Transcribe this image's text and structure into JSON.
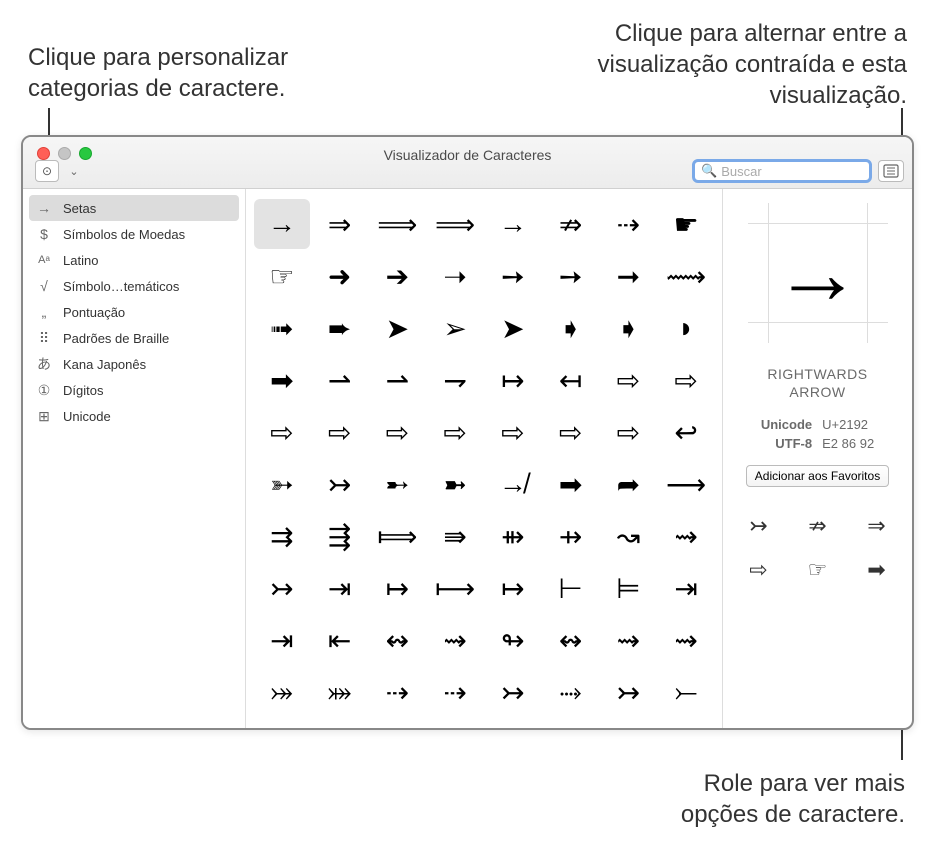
{
  "callouts": {
    "top_left": "Clique para personalizar categorias de caractere.",
    "top_right": "Clique para alternar entre a visualização contraída e esta visualização.",
    "bottom_right": "Role para ver mais opções de caractere."
  },
  "window": {
    "title": "Visualizador de Caracteres",
    "search_placeholder": "Buscar"
  },
  "sidebar": {
    "items": [
      {
        "icon": "→",
        "label": "Setas",
        "selected": true
      },
      {
        "icon": "$",
        "label": "Símbolos de Moedas"
      },
      {
        "icon": "Aあ",
        "label": "Latino"
      },
      {
        "icon": "√",
        "label": "Símbolo…temáticos"
      },
      {
        "icon": "„",
        "label": "Pontuação"
      },
      {
        "icon": "⠿",
        "label": "Padrões de Braille"
      },
      {
        "icon": "あ",
        "label": "Kana Japonês"
      },
      {
        "icon": "①",
        "label": "Dígitos"
      },
      {
        "icon": "⊞",
        "label": "Unicode"
      }
    ]
  },
  "grid": {
    "rows": [
      [
        "→",
        "⇒",
        "⟹",
        "⟹",
        "→",
        "⇏",
        "⇢",
        "☛"
      ],
      [
        "☞",
        "➜",
        "➔",
        "➝",
        "➙",
        "➙",
        "➞",
        "⟿"
      ],
      [
        "➟",
        "➨",
        "➤",
        "➢",
        "➤",
        "➧",
        "➧",
        "◗"
      ],
      [
        "➡",
        "⇀",
        "⇀",
        "⇁",
        "↦",
        "↤",
        "⇨",
        "⇨"
      ],
      [
        "⇨",
        "⇨",
        "⇨",
        "⇨",
        "⇨",
        "⇨",
        "⇨",
        "↩"
      ],
      [
        "➳",
        "↣",
        "➸",
        "➼",
        "↛",
        "➡",
        "➦",
        "⟶"
      ],
      [
        "⇉",
        "⇶",
        "⟾",
        "⇛",
        "⇻",
        "⇸",
        "↝",
        "⇝"
      ],
      [
        "↣",
        "⇥",
        "↦",
        "⟼",
        "↦",
        "⊢",
        "⊨",
        "⇥"
      ],
      [
        "⇥",
        "⇤",
        "↭",
        "⇝",
        "↬",
        "↭",
        "⇝",
        "⇝"
      ],
      [
        "⤖",
        "⤗",
        "⇢",
        "⇢",
        "↣",
        "⤑",
        "↣",
        "⤚"
      ]
    ]
  },
  "detail": {
    "glyph": "→",
    "name_line1": "RIGHTWARDS",
    "name_line2": "ARROW",
    "unicode_label": "Unicode",
    "unicode_value": "U+2192",
    "utf8_label": "UTF-8",
    "utf8_value": "E2 86 92",
    "favorite_button": "Adicionar aos Favoritos",
    "variants": [
      "↣",
      "⇏",
      "⇒",
      "⇨",
      "☞",
      "➡"
    ]
  }
}
